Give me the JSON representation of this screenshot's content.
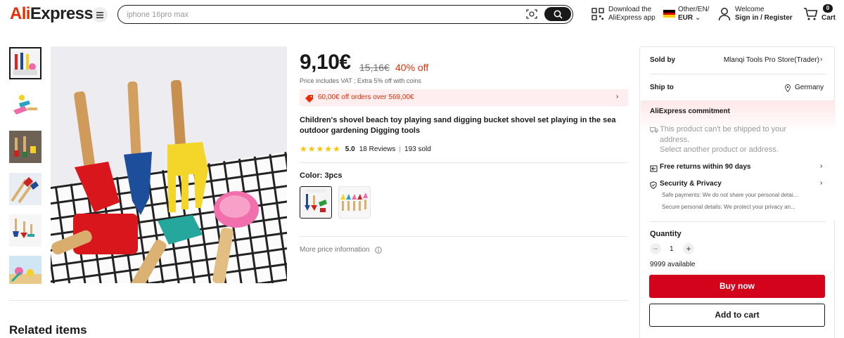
{
  "header": {
    "logo": "AliExpress",
    "search_placeholder": "iphone 16pro max",
    "download_line1": "Download the",
    "download_line2": "AliExpress app",
    "locale_line1": "Other/EN/",
    "locale_line2": "EUR",
    "welcome_line1": "Welcome",
    "welcome_line2": "Sign in / Register",
    "cart_label": "Cart",
    "cart_count": "0"
  },
  "product": {
    "price": "9,10€",
    "original_price": "15,16€",
    "discount": "40% off",
    "vat_note": "Price includes VAT ; Extra 5% off with coins",
    "promo": "60,00€ off orders over 569,00€",
    "title": "Children's shovel beach toy playing sand digging bucket shovel set playing in the sea outdoor gardening Digging tools",
    "rating": "5.0",
    "reviews": "18 Reviews",
    "sold": "193 sold",
    "color_label": "Color: 3pcs",
    "more_price_info": "More price information",
    "related_items": "Related items"
  },
  "panel": {
    "sold_by_label": "Sold by",
    "seller": "Mlanqi Tools Pro Store(Trader)",
    "ship_to_label": "Ship to",
    "ship_to_value": "Germany",
    "commitment_title": "AliExpress commitment",
    "ship_warning_line1": "This product can't be shipped to your",
    "ship_warning_line2": "address.",
    "ship_warning_line3": "Select another product or address.",
    "free_returns": "Free returns within 90 days",
    "security_title": "Security & Privacy",
    "security_line1": "Safe payments: We do not share your personal detai...",
    "security_line2": "Secure personal details: We protect your privacy an...",
    "quantity_label": "Quantity",
    "quantity_value": "1",
    "available": "9999 available",
    "buy_now": "Buy now",
    "add_to_cart": "Add to cart"
  },
  "colors": {
    "brand_red": "#e62e04",
    "buy_red": "#d3031c",
    "star": "#fdc200"
  }
}
